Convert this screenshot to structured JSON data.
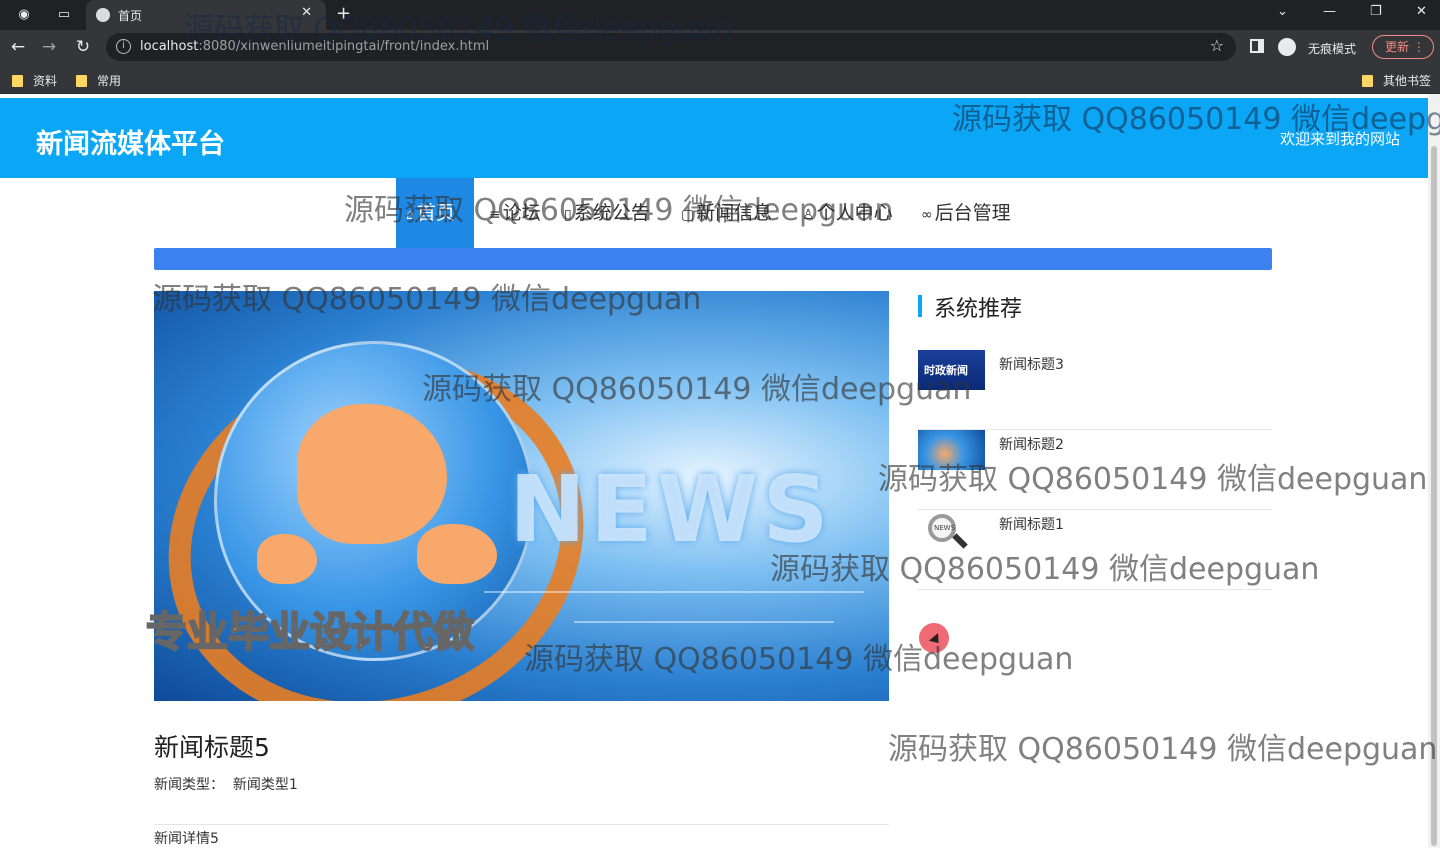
{
  "browser": {
    "tab_title": "首页",
    "url_host": "localhost",
    "url_path": ":8080/xinwenliumeitipingtai/front/index.html",
    "incognito_label": "无痕模式",
    "update_label": "更新",
    "bookmarks": [
      "资料",
      "常用"
    ],
    "other_bookmarks": "其他书签"
  },
  "site": {
    "title": "新闻流媒体平台",
    "subtitle": "欢迎来到我的网站"
  },
  "menu": [
    {
      "label": "首页",
      "icon": "home-icon",
      "active": true
    },
    {
      "label": "论坛",
      "icon": "forum-icon"
    },
    {
      "label": "系统公告",
      "icon": "notice-icon"
    },
    {
      "label": "新闻信息",
      "icon": "news-icon"
    },
    {
      "label": "个人中心",
      "icon": "user-icon"
    },
    {
      "label": "后台管理",
      "icon": "link-icon"
    }
  ],
  "article": {
    "hero_text": "NEWS",
    "title": "新闻标题5",
    "type_label": "新闻类型：",
    "type_value": "新闻类型1",
    "detail": "新闻详情5"
  },
  "sidebar": {
    "heading": "系统推荐",
    "items": [
      {
        "title": "新闻标题3",
        "thumb_text": "时政新闻"
      },
      {
        "title": "新闻标题2"
      },
      {
        "title": "新闻标题1",
        "thumb_text": "NEWS"
      }
    ]
  },
  "overlay": {
    "watermark": "源码获取 QQ86050149 微信deepguan",
    "stamp": "专业毕业设计代做"
  },
  "colors": {
    "header_bg": "#0ba6f5",
    "menu_active": "#1e88e5",
    "strip": "#3b82f0"
  }
}
